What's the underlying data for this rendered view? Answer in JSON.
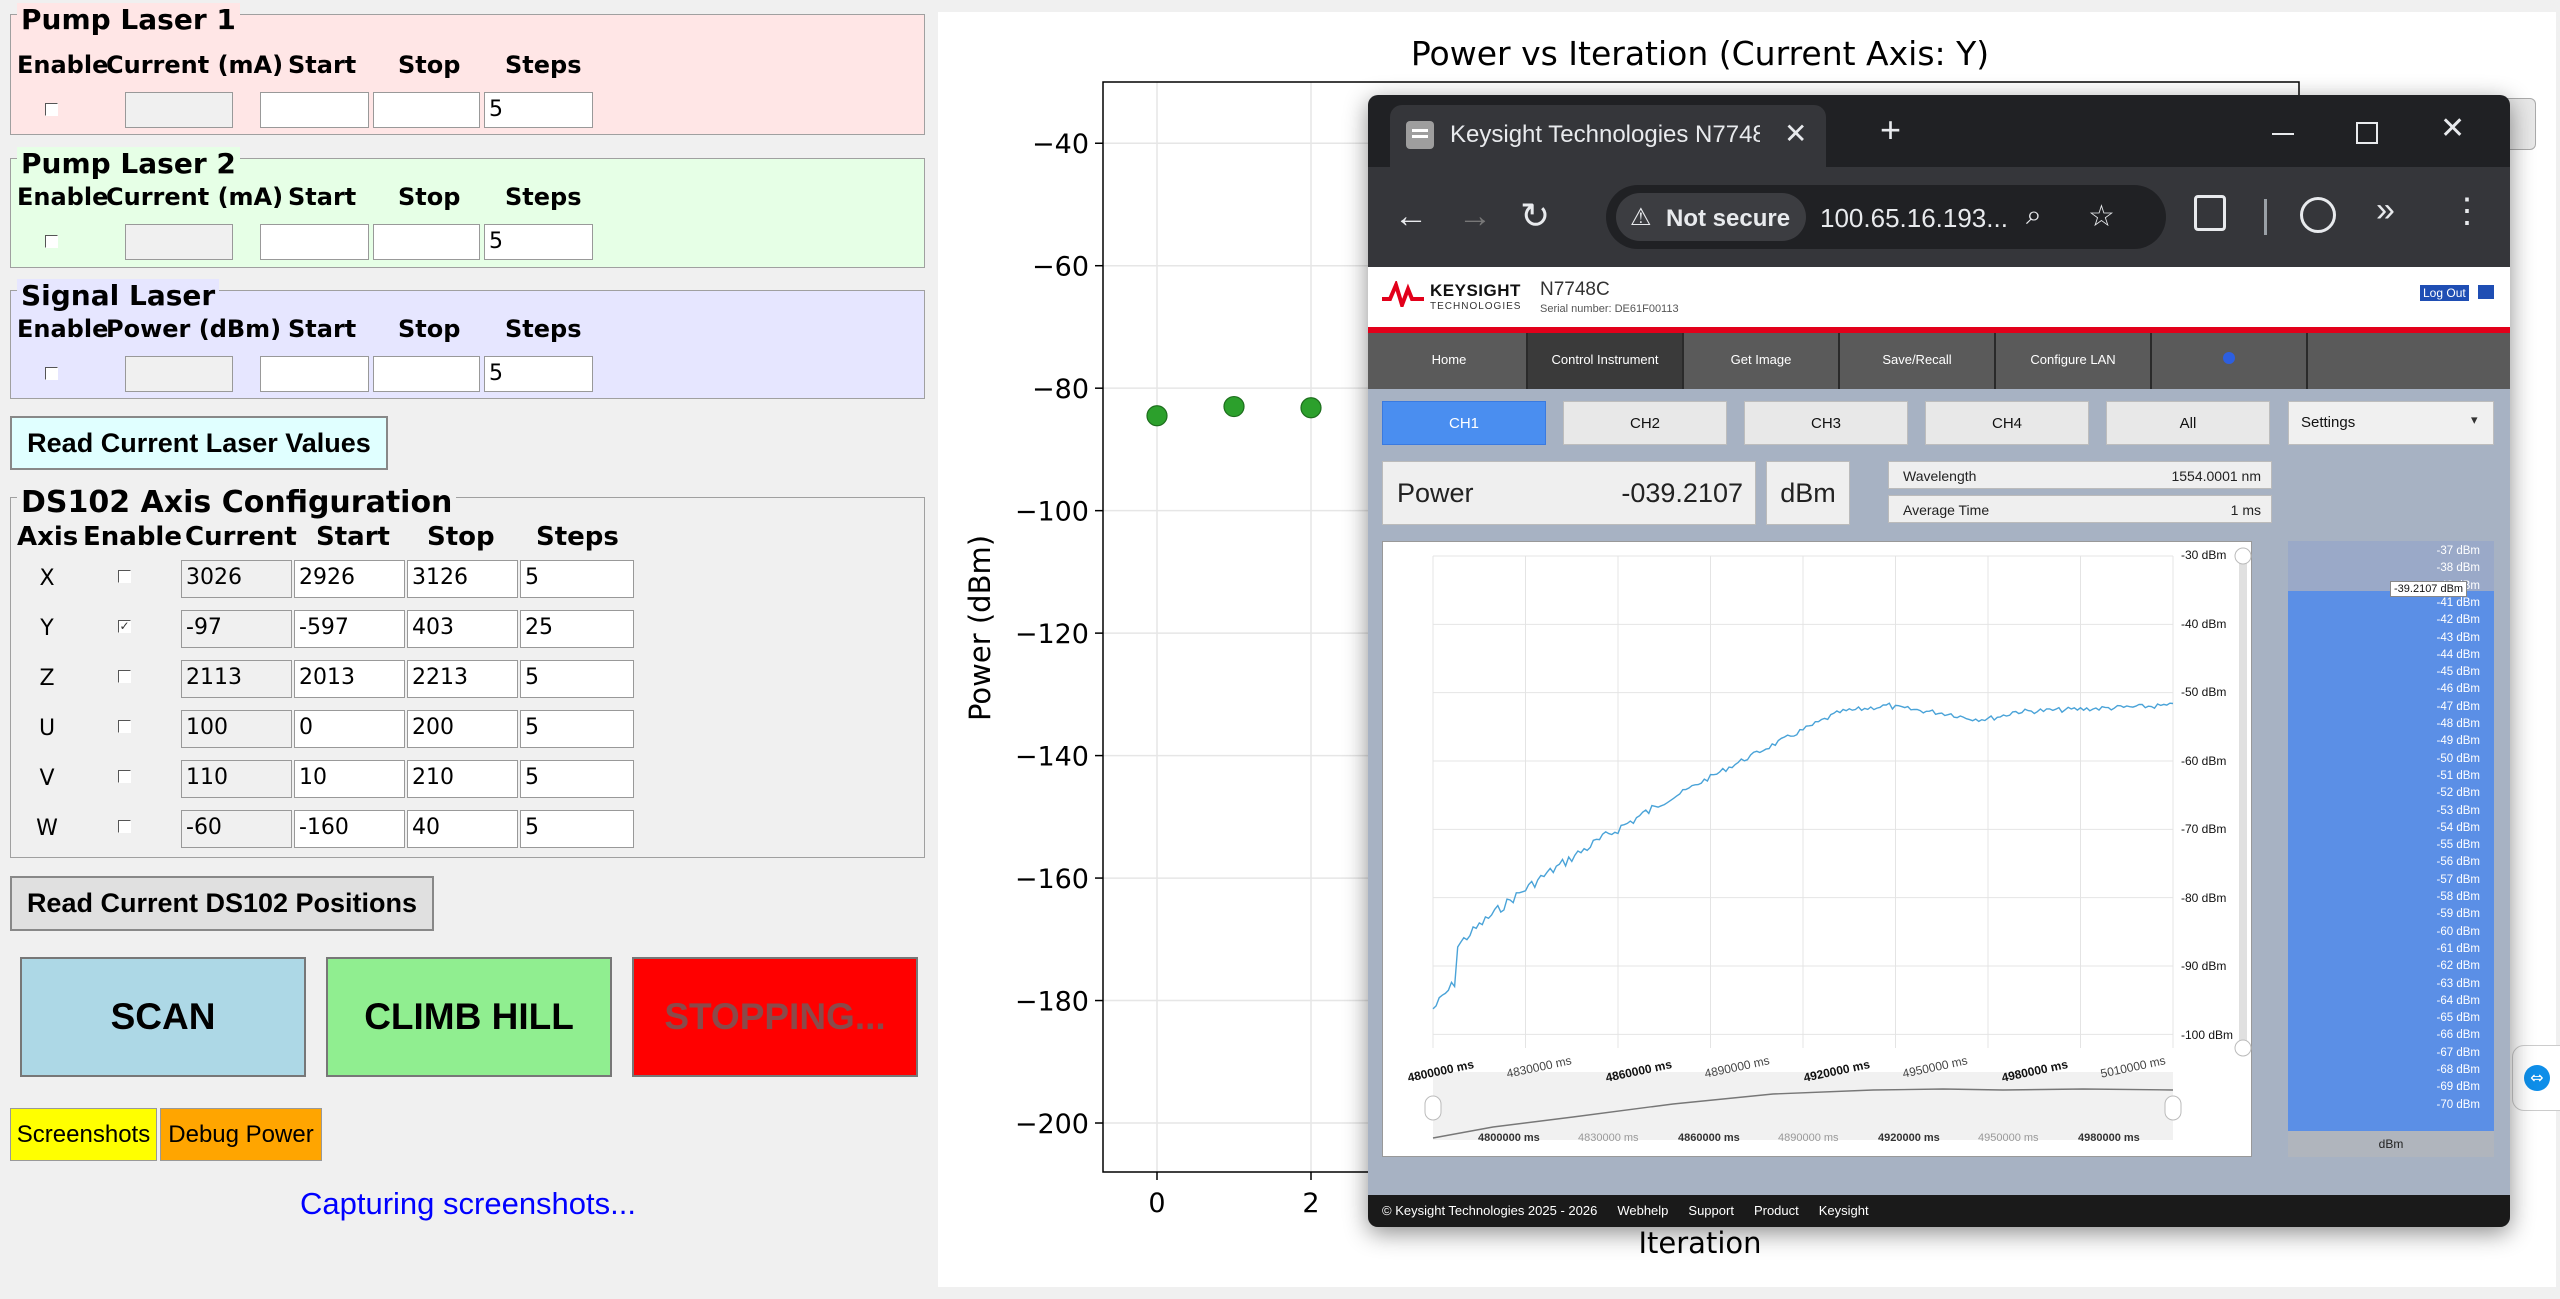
{
  "pump1": {
    "title": "Pump Laser 1",
    "h_enable": "Enable",
    "h_current": "Current (mA)",
    "h_start": "Start",
    "h_stop": "Stop",
    "h_steps": "Steps",
    "current": "",
    "start": "",
    "stop": "",
    "steps": "5"
  },
  "pump2": {
    "title": "Pump Laser 2",
    "h_enable": "Enable",
    "h_current": "Current (mA)",
    "h_start": "Start",
    "h_stop": "Stop",
    "h_steps": "Steps",
    "current": "",
    "start": "",
    "stop": "",
    "steps": "5"
  },
  "signal": {
    "title": "Signal Laser",
    "h_enable": "Enable",
    "h_power": "Power (dBm)",
    "h_start": "Start",
    "h_stop": "Stop",
    "h_steps": "Steps",
    "power": "",
    "start": "",
    "stop": "",
    "steps": "5"
  },
  "read_laser_label": "Read Current Laser Values",
  "ds102": {
    "title": "DS102 Axis Configuration",
    "h_axis": "Axis",
    "h_enable": "Enable",
    "h_current": "Current",
    "h_start": "Start",
    "h_stop": "Stop",
    "h_steps": "Steps",
    "rows": [
      {
        "axis": "X",
        "enabled": false,
        "current": "3026",
        "start": "2926",
        "stop": "3126",
        "steps": "5"
      },
      {
        "axis": "Y",
        "enabled": true,
        "current": "-97",
        "start": "-597",
        "stop": "403",
        "steps": "25"
      },
      {
        "axis": "Z",
        "enabled": false,
        "current": "2113",
        "start": "2013",
        "stop": "2213",
        "steps": "5"
      },
      {
        "axis": "U",
        "enabled": false,
        "current": "100",
        "start": "0",
        "stop": "200",
        "steps": "5"
      },
      {
        "axis": "V",
        "enabled": false,
        "current": "110",
        "start": "10",
        "stop": "210",
        "steps": "5"
      },
      {
        "axis": "W",
        "enabled": false,
        "current": "-60",
        "start": "-160",
        "stop": "40",
        "steps": "5"
      }
    ]
  },
  "read_ds102_label": "Read Current DS102 Positions",
  "scan_label": "SCAN",
  "climb_label": "CLIMB HILL",
  "stopping_label": "STOPPING...",
  "screenshots_label": "Screenshots",
  "debug_label": "Debug Power",
  "status_text": "Capturing screenshots...",
  "colors": {
    "pump1_bg": "#ffe6e6",
    "pump2_bg": "#e6ffe6",
    "signal_bg": "#e6e6ff",
    "scan": "#add8e6",
    "climb": "#90ee90",
    "stop": "#ff0000",
    "screenshots": "#ffff00",
    "debug": "#ffa500",
    "status": "#0000ff",
    "marker": "#2ca02c"
  },
  "chart_data": {
    "type": "scatter",
    "title": "Power vs Iteration (Current Axis: Y)",
    "xlabel": "Iteration",
    "ylabel": "Power (dBm)",
    "y_ticks": [
      -40,
      -60,
      -80,
      -100,
      -120,
      -140,
      -160,
      -180,
      -200
    ],
    "x_ticks": [
      0,
      2
    ],
    "ylim": [
      -208,
      -30
    ],
    "grid": true,
    "series": [
      {
        "x": [
          0,
          1,
          2
        ],
        "y": [
          -84.5,
          -83,
          -83.2
        ]
      }
    ]
  },
  "browser": {
    "tab_title": "Keysight Technologies N7748C",
    "not_secure": "Not secure",
    "url": "100.65.16.193...",
    "logo_main": "KEYSIGHT",
    "logo_sub": "TECHNOLOGIES",
    "model": "N7748C",
    "serial": "Serial number: DE61F00113",
    "logout": "Log Out",
    "nav": [
      "Home",
      "Control Instrument",
      "Get Image",
      "Save/Recall",
      "Configure LAN",
      ""
    ],
    "channels": [
      "CH1",
      "CH2",
      "CH3",
      "CH4",
      "All"
    ],
    "settings": "Settings",
    "power_label": "Power",
    "power_value": "-039.2107",
    "power_unit": "dBm",
    "wavelength_label": "Wavelength",
    "wavelength_value": "1554.0001 nm",
    "avgtime_label": "Average Time",
    "avgtime_value": "1 ms",
    "trace_scale": [
      "-30 dBm",
      "-40 dBm",
      "-50 dBm",
      "-60 dBm",
      "-70 dBm",
      "-80 dBm",
      "-90 dBm",
      "-100 dBm"
    ],
    "trace_times": [
      "4800000 ms",
      "4830000 ms",
      "4860000 ms",
      "4890000 ms",
      "4920000 ms",
      "4950000 ms",
      "4980000 ms",
      "5010000 ms"
    ],
    "overview_times": [
      "4800000 ms",
      "4830000 ms",
      "4860000 ms",
      "4890000 ms",
      "4920000 ms",
      "4950000 ms",
      "4980000 ms"
    ],
    "bar_labels": [
      "-37 dBm",
      "-38 dBm",
      "-40 dBm",
      "-41 dBm",
      "-42 dBm",
      "-43 dBm",
      "-44 dBm",
      "-45 dBm",
      "-46 dBm",
      "-47 dBm",
      "-48 dBm",
      "-49 dBm",
      "-50 dBm",
      "-51 dBm",
      "-52 dBm",
      "-53 dBm",
      "-54 dBm",
      "-55 dBm",
      "-56 dBm",
      "-57 dBm",
      "-58 dBm",
      "-59 dBm",
      "-60 dBm",
      "-61 dBm",
      "-62 dBm",
      "-63 dBm",
      "-64 dBm",
      "-65 dBm",
      "-66 dBm",
      "-67 dBm",
      "-68 dBm",
      "-69 dBm",
      "-70 dBm"
    ],
    "bar_marker": "-39.2107 dBm",
    "bar_unit": "dBm",
    "footer": [
      "© Keysight Technologies 2025 - 2026",
      "Webhelp",
      "Support",
      "Product",
      "Keysight"
    ]
  }
}
